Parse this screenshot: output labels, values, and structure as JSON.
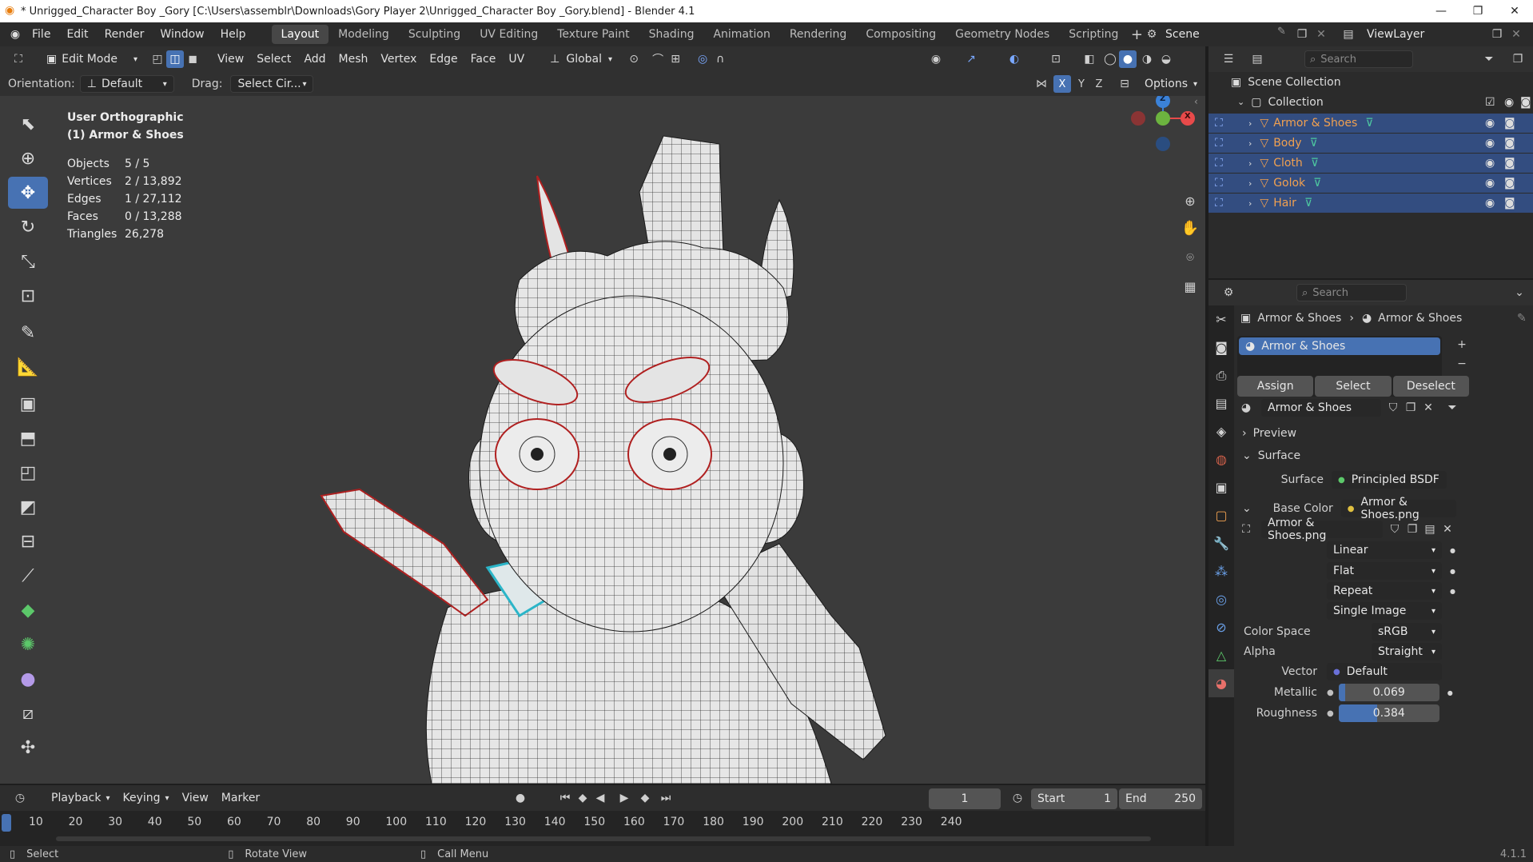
{
  "window": {
    "title": "* Unrigged_Character Boy _Gory [C:\\Users\\assemblr\\Downloads\\Gory Player 2\\Unrigged_Character Boy _Gory.blend] - Blender 4.1",
    "minimize": "—",
    "maximize": "❐",
    "close": "✕"
  },
  "menu": [
    "File",
    "Edit",
    "Render",
    "Window",
    "Help"
  ],
  "workspaces": [
    "Layout",
    "Modeling",
    "Sculpting",
    "UV Editing",
    "Texture Paint",
    "Shading",
    "Animation",
    "Rendering",
    "Compositing",
    "Geometry Nodes",
    "Scripting"
  ],
  "active_workspace": "Layout",
  "scene": {
    "name": "Scene",
    "view_layer": "ViewLayer"
  },
  "viewport_header": {
    "mode": "Edit Mode",
    "menus": [
      "View",
      "Select",
      "Add",
      "Mesh",
      "Vertex",
      "Edge",
      "Face",
      "UV"
    ],
    "transform_orientation": "Global",
    "orientation_label": "Orientation:",
    "orientation_value": "Default",
    "drag_label": "Drag:",
    "drag_value": "Select Cir...",
    "axes": [
      "X",
      "Y",
      "Z"
    ],
    "options": "Options"
  },
  "overlay_stats": {
    "view": "User Orthographic",
    "object": "(1) Armor & Shoes",
    "rows": [
      {
        "k": "Objects",
        "v": "5 / 5"
      },
      {
        "k": "Vertices",
        "v": "2 / 13,892"
      },
      {
        "k": "Edges",
        "v": "1 / 27,112"
      },
      {
        "k": "Faces",
        "v": "0 / 13,288"
      },
      {
        "k": "Triangles",
        "v": "26,278"
      }
    ]
  },
  "gizmo": {
    "x": "X",
    "y": "Y",
    "z": "Z"
  },
  "timeline": {
    "menus": [
      "Playback",
      "Keying",
      "View",
      "Marker"
    ],
    "current_frame": "1",
    "start_label": "Start",
    "start": "1",
    "end_label": "End",
    "end": "250",
    "ticks": [
      "10",
      "20",
      "30",
      "40",
      "50",
      "60",
      "70",
      "80",
      "90",
      "100",
      "110",
      "120",
      "130",
      "140",
      "150",
      "160",
      "170",
      "180",
      "190",
      "200",
      "210",
      "220",
      "230",
      "240"
    ]
  },
  "statusbar": {
    "select": "Select",
    "rotate": "Rotate View",
    "menu": "Call Menu",
    "version": "4.1.1"
  },
  "outliner": {
    "search_placeholder": "Search",
    "scene_collection": "Scene Collection",
    "collection": "Collection",
    "objects": [
      "Armor & Shoes",
      "Body",
      "Cloth",
      "Golok",
      "Hair"
    ]
  },
  "properties": {
    "search_placeholder": "Search",
    "breadcrumb_object": "Armor & Shoes",
    "breadcrumb_material": "Armor & Shoes",
    "slot": "Armor & Shoes",
    "assign": "Assign",
    "select": "Select",
    "deselect": "Deselect",
    "material_name": "Armor & Shoes",
    "preview": "Preview",
    "surface_panel": "Surface",
    "surface_label": "Surface",
    "surface_value": "Principled BSDF",
    "base_color_label": "Base Color",
    "base_color_value": "Armor & Shoes.png",
    "image_name": "Armor & Shoes.png",
    "interpolation": "Linear",
    "projection": "Flat",
    "extension": "Repeat",
    "source": "Single Image",
    "color_space_label": "Color Space",
    "color_space": "sRGB",
    "alpha_label": "Alpha",
    "alpha": "Straight",
    "vector_label": "Vector",
    "vector": "Default",
    "metallic_label": "Metallic",
    "metallic": "0.069",
    "roughness_label": "Roughness",
    "roughness": "0.384"
  },
  "colors": {
    "accent": "#4772b3",
    "selected_row": "#334d80",
    "object_orange": "#f0a050",
    "mesh_green": "#4ec9a0"
  }
}
